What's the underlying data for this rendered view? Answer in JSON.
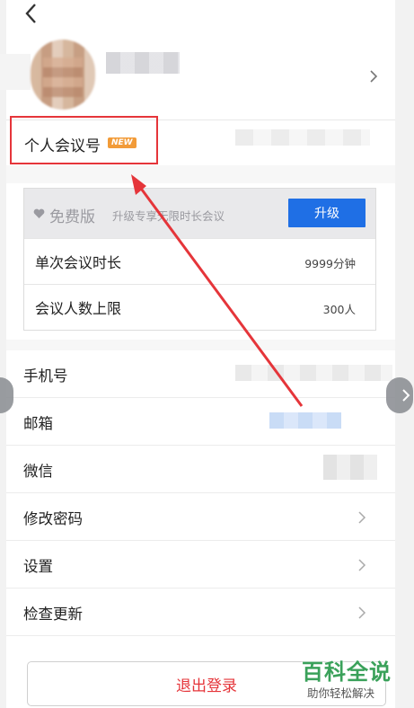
{
  "profile": {
    "meeting_id_label": "个人会议号",
    "new_badge": "NEW"
  },
  "plan": {
    "name": "免费版",
    "description": "升级专享无限时长会议",
    "upgrade_label": "升级",
    "rows": [
      {
        "label": "单次会议时长",
        "value": "9999分钟"
      },
      {
        "label": "会议人数上限",
        "value": "300人"
      }
    ]
  },
  "list": {
    "phone_label": "手机号",
    "email_label": "邮箱",
    "wechat_label": "微信",
    "change_password_label": "修改密码",
    "settings_label": "设置",
    "check_update_label": "检查更新"
  },
  "logout_label": "退出登录",
  "watermark": {
    "title": "百科全说",
    "subtitle": "助你轻松解决"
  },
  "colors": {
    "accent_blue": "#1f6fe5",
    "highlight_red": "#e5353a",
    "badge_orange": "#f29b38"
  }
}
